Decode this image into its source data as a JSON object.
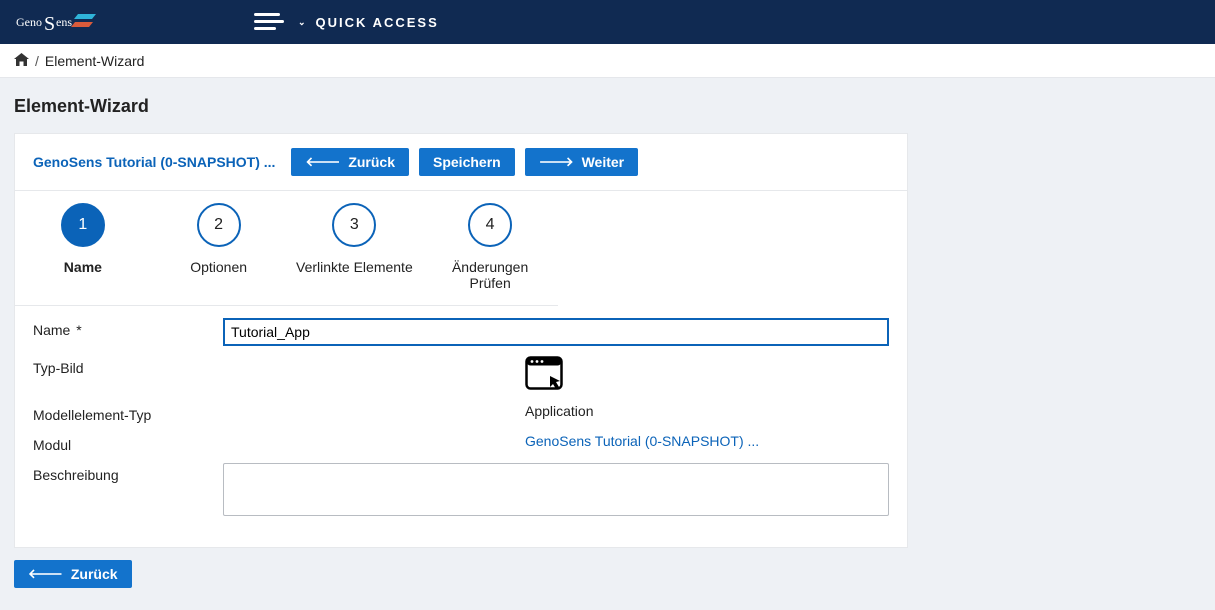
{
  "topbar": {
    "quick_access": "QUICK ACCESS"
  },
  "breadcrumb": {
    "current": "Element-Wizard"
  },
  "page_title": "Element-Wizard",
  "header": {
    "module_link": "GenoSens Tutorial (0-SNAPSHOT) ...",
    "back_label": "Zurück",
    "save_label": "Speichern",
    "next_label": "Weiter"
  },
  "steps": [
    {
      "num": "1",
      "label": "Name"
    },
    {
      "num": "2",
      "label": "Optionen"
    },
    {
      "num": "3",
      "label": "Verlinkte Elemente"
    },
    {
      "num": "4",
      "label": "Änderungen Prüfen"
    }
  ],
  "form": {
    "name_label": "Name",
    "name_req": "*",
    "name_value": "Tutorial_App",
    "typbild_label": "Typ-Bild",
    "modeltype_label": "Modellelement-Typ",
    "modeltype_value": "Application",
    "modul_label": "Modul",
    "modul_value": "GenoSens Tutorial (0-SNAPSHOT) ...",
    "desc_label": "Beschreibung",
    "desc_value": ""
  },
  "footer": {
    "back_label": "Zurück"
  }
}
